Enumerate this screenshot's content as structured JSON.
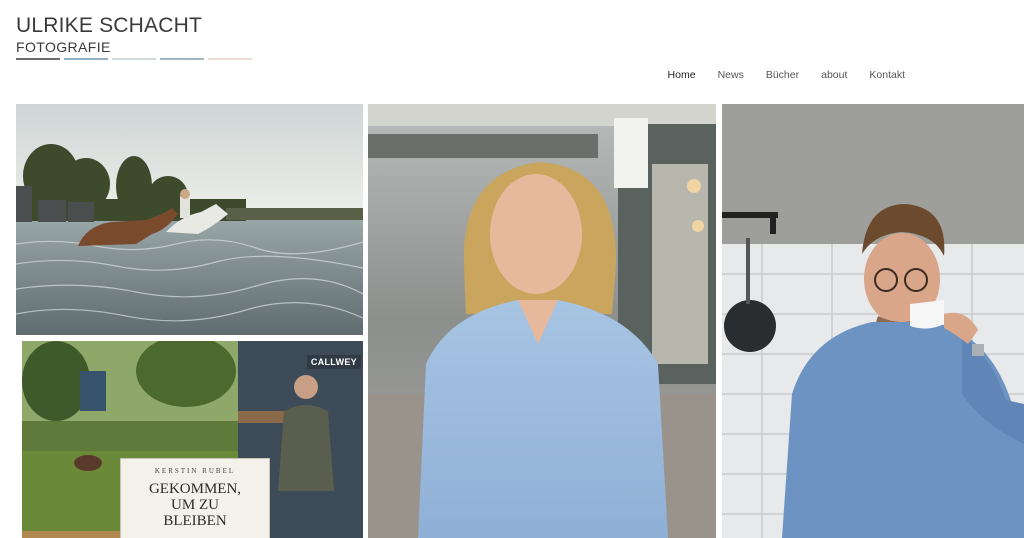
{
  "brand": {
    "name": "ULRIKE SCHACHT",
    "subtitle": "FOTOGRAFIE",
    "bar_colors": [
      "#6b6b6b",
      "#8fb0c6",
      "#d3d8dc",
      "#9fb8c4",
      "#ecdcd3"
    ]
  },
  "nav": {
    "items": [
      {
        "label": "Home",
        "active": true
      },
      {
        "label": "News",
        "active": false
      },
      {
        "label": "Bücher",
        "active": false
      },
      {
        "label": "about",
        "active": false
      },
      {
        "label": "Kontakt",
        "active": false
      }
    ]
  },
  "gallery": {
    "book": {
      "publisher": "CALLWEY",
      "author": "KERSTIN RUBEL",
      "title_line1": "GEKOMMEN,",
      "title_line2": "UM ZU",
      "title_line3": "BLEIBEN"
    }
  }
}
